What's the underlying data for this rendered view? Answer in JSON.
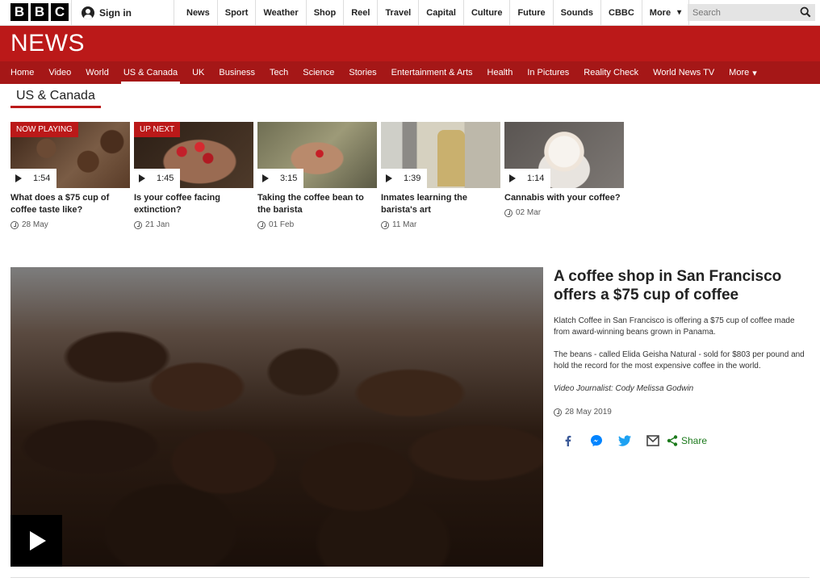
{
  "bbc_logo": [
    "B",
    "B",
    "C"
  ],
  "account": {
    "signin_label": "Sign in"
  },
  "top_nav": [
    "News",
    "Sport",
    "Weather",
    "Shop",
    "Reel",
    "Travel",
    "Capital",
    "Culture",
    "Future",
    "Sounds",
    "CBBC",
    "More"
  ],
  "search": {
    "placeholder": "Search"
  },
  "news_banner": {
    "title": "NEWS"
  },
  "section_nav": [
    "Home",
    "Video",
    "World",
    "US & Canada",
    "UK",
    "Business",
    "Tech",
    "Science",
    "Stories",
    "Entertainment & Arts",
    "Health",
    "In Pictures",
    "Reality Check",
    "World News TV",
    "More"
  ],
  "section_nav_active": "US & Canada",
  "section_title": "US & Canada",
  "videos": [
    {
      "badge": "NOW PLAYING",
      "duration": "1:54",
      "title": "What does a $75 cup of coffee taste like?",
      "date": "28 May"
    },
    {
      "badge": "UP NEXT",
      "duration": "1:45",
      "title": "Is your coffee facing extinction?",
      "date": "21 Jan"
    },
    {
      "badge": "",
      "duration": "3:15",
      "title": "Taking the coffee bean to the barista",
      "date": "01 Feb"
    },
    {
      "badge": "",
      "duration": "1:39",
      "title": "Inmates learning the barista's art",
      "date": "11 Mar"
    },
    {
      "badge": "",
      "duration": "1:14",
      "title": "Cannabis with your coffee?",
      "date": "02 Mar"
    }
  ],
  "story": {
    "headline": "A coffee shop in San Francisco offers a $75 cup of coffee",
    "para1": "Klatch Coffee in San Francisco is offering a $75 cup of coffee made from award-winning beans grown in Panama.",
    "para2": "The beans - called Elida Geisha Natural - sold for $803 per pound and hold the record for the most expensive coffee in the world.",
    "credit": "Video Journalist: Cody Melissa Godwin",
    "date": "28 May 2019"
  },
  "share": {
    "label": "Share",
    "icons": [
      "facebook-icon",
      "messenger-icon",
      "twitter-icon",
      "email-icon",
      "share-icon"
    ]
  },
  "colors": {
    "brand_red": "#bb1919",
    "nav_red": "#a51717",
    "share_green": "#1c7a1c"
  }
}
